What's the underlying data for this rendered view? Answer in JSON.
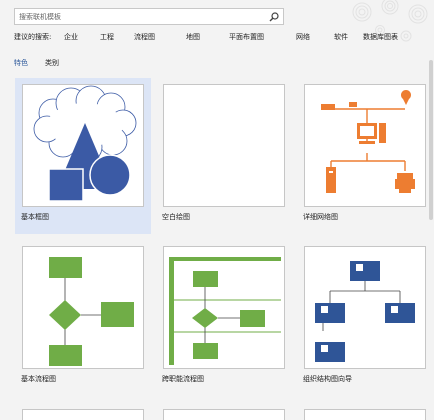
{
  "search": {
    "placeholder": "搜索联机模板"
  },
  "suggestions": {
    "label": "建议的搜索:",
    "items": [
      "企业",
      "工程",
      "流程图",
      "地图",
      "平面布置图",
      "网络",
      "软件",
      "数据库图表"
    ]
  },
  "tabs": {
    "featured": "特色",
    "category": "类别"
  },
  "templates": [
    {
      "caption": "基本框图",
      "selected": true
    },
    {
      "caption": "空白绘图",
      "selected": false
    },
    {
      "caption": "详细网络图",
      "selected": false
    },
    {
      "caption": "基本流程图",
      "selected": false
    },
    {
      "caption": "跨职能流程图",
      "selected": false
    },
    {
      "caption": "组织结构图向导",
      "selected": false
    }
  ],
  "colors": {
    "accent": "#2b579a",
    "selected_bg": "#dce5f6",
    "shape_blue": "#3b5aa5",
    "flow_green": "#70ad47",
    "network_orange": "#ed7d31",
    "org_blue": "#2f5597"
  }
}
